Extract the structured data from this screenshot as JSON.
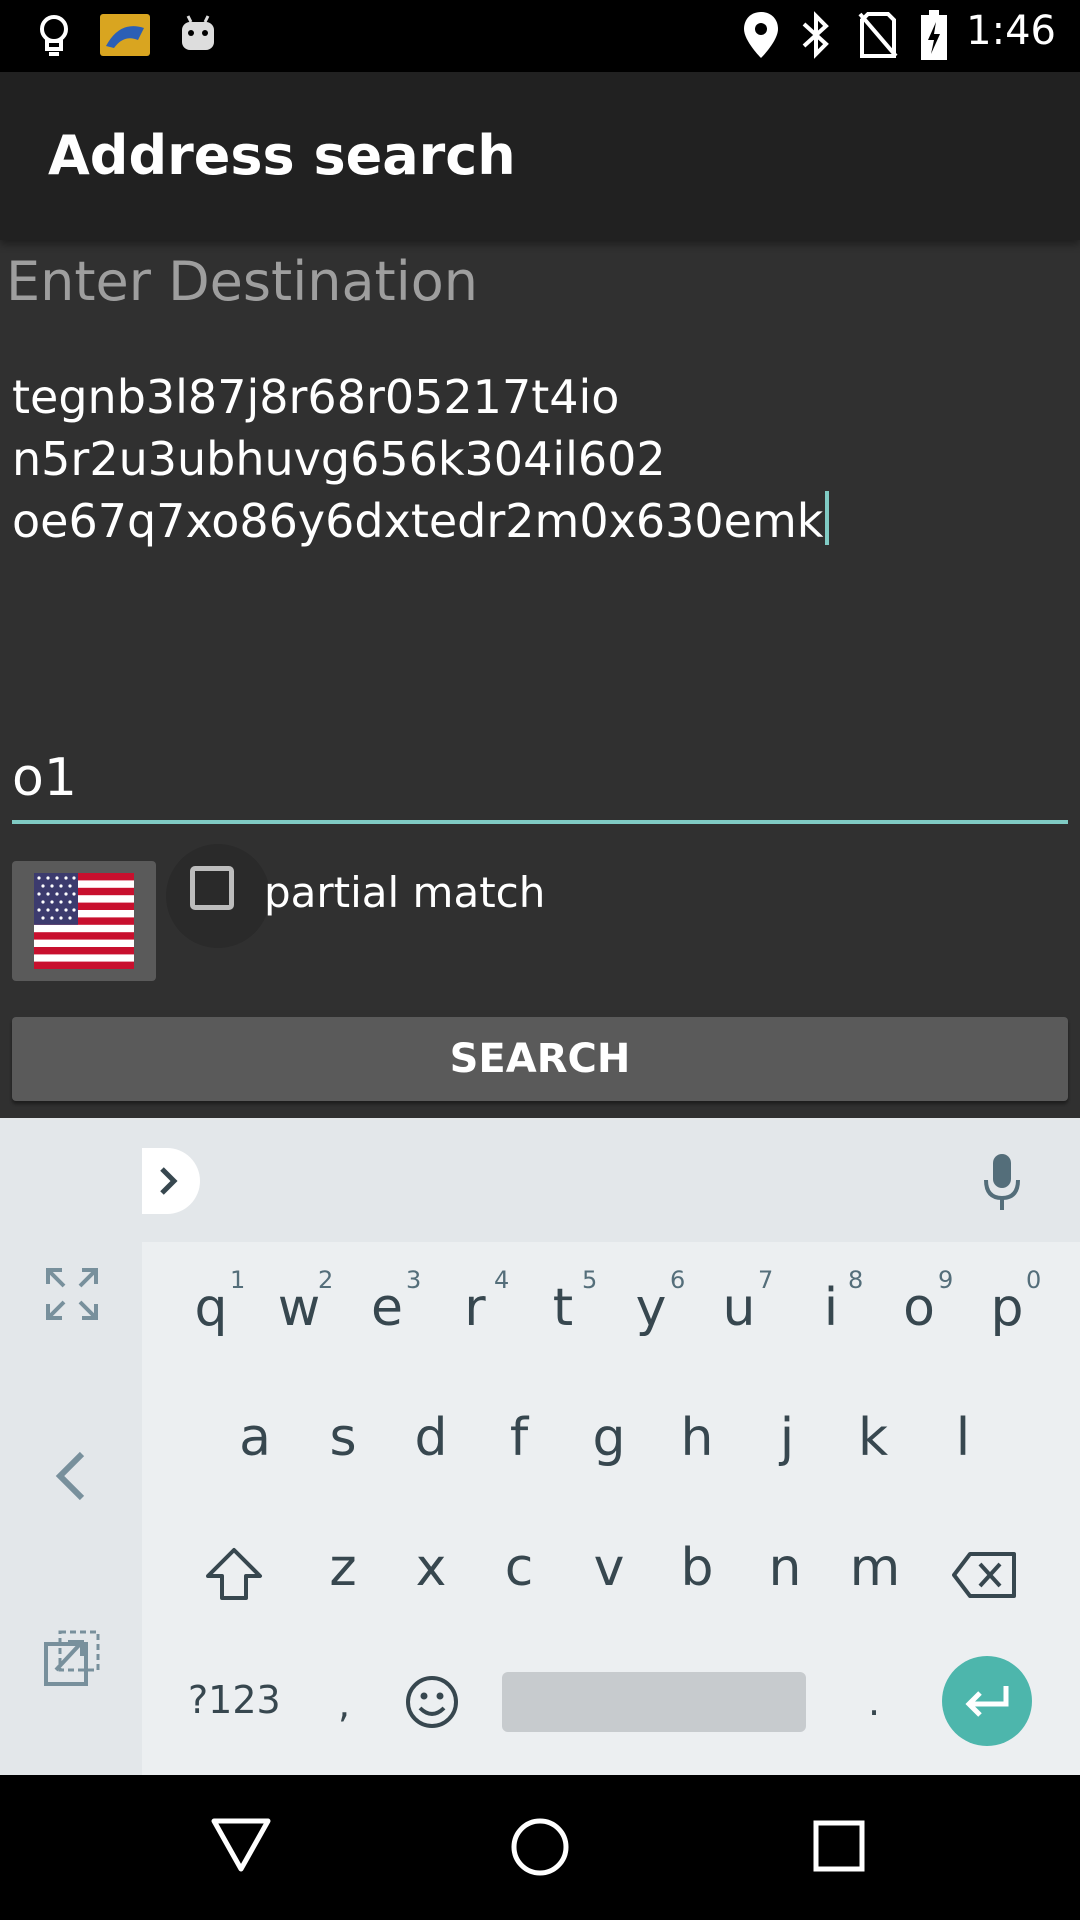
{
  "status_bar": {
    "time": "1:46",
    "left_icons": [
      "lightbulb-icon",
      "app-photo-icon",
      "android-icon"
    ],
    "right_icons": [
      "location-icon",
      "bluetooth-icon",
      "no-sim-icon",
      "battery-charging-icon"
    ]
  },
  "app_bar": {
    "title": "Address search"
  },
  "form": {
    "heading": "Enter Destination",
    "destination_lines": [
      "tegnb3l87j8r68r05217t4io",
      "n5r2u3ubhuvg656k304il602",
      "oe67q7xo86y6dxtedr2m0x630emk"
    ],
    "second_field_value": "o1",
    "country_flag": "us-flag-icon",
    "partial_match_label": "partial match",
    "partial_match_checked": false,
    "search_button_label": "SEARCH"
  },
  "keyboard": {
    "row1": [
      {
        "key": "q",
        "hint": "1"
      },
      {
        "key": "w",
        "hint": "2"
      },
      {
        "key": "e",
        "hint": "3"
      },
      {
        "key": "r",
        "hint": "4"
      },
      {
        "key": "t",
        "hint": "5"
      },
      {
        "key": "y",
        "hint": "6"
      },
      {
        "key": "u",
        "hint": "7"
      },
      {
        "key": "i",
        "hint": "8"
      },
      {
        "key": "o",
        "hint": "9"
      },
      {
        "key": "p",
        "hint": "0"
      }
    ],
    "row2": [
      "a",
      "s",
      "d",
      "f",
      "g",
      "h",
      "j",
      "k",
      "l"
    ],
    "row3": [
      "z",
      "x",
      "c",
      "v",
      "b",
      "n",
      "m"
    ],
    "symbols_label": "?123",
    "comma": ",",
    "period": ".",
    "accent_color": "#4db6ac"
  },
  "nav_bar": {
    "icons": [
      "back-icon",
      "home-icon",
      "recents-icon"
    ]
  }
}
